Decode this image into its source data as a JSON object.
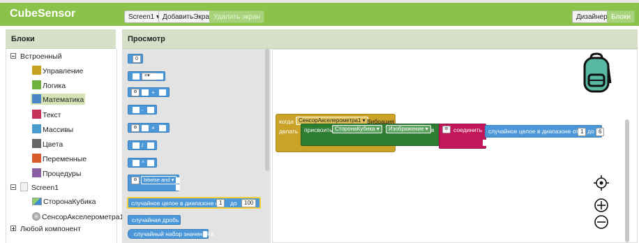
{
  "topbar": {
    "app_title": "CubeSensor",
    "screen_dropdown": "Screen1",
    "add_screen": "ДобавитьЭкран",
    "remove_screen": "Удалить экран",
    "designer": "Дизайнер",
    "blocks": "Блоки"
  },
  "left_panel": {
    "header": "Блоки",
    "builtin": "Встроенный",
    "categories": [
      {
        "label": "Управление",
        "color": "#c8a21f"
      },
      {
        "label": "Логика",
        "color": "#6fb33d"
      },
      {
        "label": "Математика",
        "color": "#4a86c8"
      },
      {
        "label": "Текст",
        "color": "#c5305a"
      },
      {
        "label": "Массивы",
        "color": "#4a9bd0"
      },
      {
        "label": "Цвета",
        "color": "#666666"
      },
      {
        "label": "Переменные",
        "color": "#d75b2a"
      },
      {
        "label": "Процедуры",
        "color": "#8a5fa3"
      }
    ],
    "screen": "Screen1",
    "components": [
      "СторонаКубика",
      "СенсорАкселерометра1"
    ],
    "any_component": "Любой компонент"
  },
  "viewer": {
    "header": "Просмотр"
  },
  "drawer": {
    "number_value": "0",
    "bitwise": "bitwise and",
    "random_int": "случайное целое в диапазоне от",
    "random_int_to": "до",
    "random_from": "1",
    "random_to": "100",
    "random_fraction": "случайная дробь",
    "random_seed": "случайный набор значений  в"
  },
  "workspace": {
    "event_when": "когда",
    "event_component": "СенсорАкселерометра1",
    "event_name": "Вибрация",
    "event_do": "делать",
    "set_label": "присвоить",
    "set_component": "СторонаКубика",
    "set_property": "Изображение",
    "set_to": "в",
    "join_label": "соединить",
    "random_label": "случайное целое в диапазоне от",
    "random_to": "до",
    "random_from": "1",
    "random_to_value": "6"
  },
  "colors": {
    "topbar": "#8bc34a",
    "event": "#c9a227",
    "set": "#2e7d32",
    "join": "#c2185b",
    "math": "#4c97d7"
  }
}
